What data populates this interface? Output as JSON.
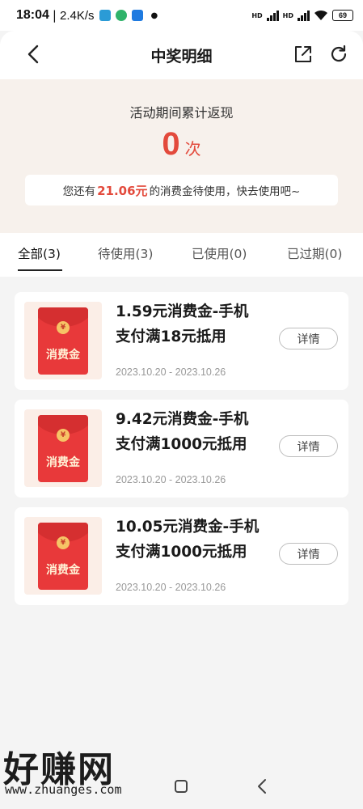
{
  "status_bar": {
    "time": "18:04",
    "speed": "2.4K/s",
    "battery": "69",
    "signal_labels": [
      "HD",
      "HD"
    ]
  },
  "header": {
    "title": "中奖明细"
  },
  "summary": {
    "label": "活动期间累计返现",
    "count": "0",
    "unit": "次",
    "notice_prefix": "您还有",
    "notice_amount": "21.06元",
    "notice_suffix": "的消费金待使用，快去使用吧~"
  },
  "tabs": [
    {
      "label": "全部(3)",
      "active": true
    },
    {
      "label": "待使用(3)",
      "active": false
    },
    {
      "label": "已使用(0)",
      "active": false
    },
    {
      "label": "已过期(0)",
      "active": false
    }
  ],
  "envelope_label": "消费金",
  "envelope_coin": "¥",
  "coupons": [
    {
      "title_line1": "1.59元消费金-手机",
      "title_line2": "支付满18元抵用",
      "date": "2023.10.20 - 2023.10.26",
      "button": "详情"
    },
    {
      "title_line1": "9.42元消费金-手机",
      "title_line2": "支付满1000元抵用",
      "date": "2023.10.20 - 2023.10.26",
      "button": "详情"
    },
    {
      "title_line1": "10.05元消费金-手机",
      "title_line2": "支付满1000元抵用",
      "date": "2023.10.20 - 2023.10.26",
      "button": "详情"
    }
  ],
  "watermark": {
    "text": "好赚网",
    "url": "www.zhuanges.com"
  },
  "colors": {
    "accent": "#e34a3c",
    "summary_bg": "#f7f1ec",
    "envelope": "#e8393a"
  }
}
